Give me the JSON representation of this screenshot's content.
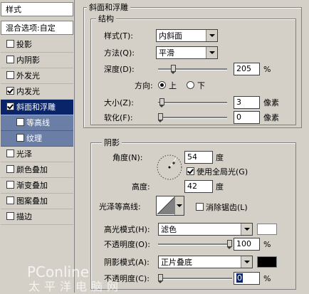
{
  "sidebar": {
    "title": "样式",
    "blend_options": "混合选项:自定",
    "items": [
      {
        "label": "投影",
        "checked": false
      },
      {
        "label": "内阴影",
        "checked": false
      },
      {
        "label": "外发光",
        "checked": false
      },
      {
        "label": "内发光",
        "checked": true
      },
      {
        "label": "斜面和浮雕",
        "checked": true
      },
      {
        "label": "等高线",
        "checked": false
      },
      {
        "label": "纹理",
        "checked": false
      },
      {
        "label": "光泽",
        "checked": false
      },
      {
        "label": "颜色叠加",
        "checked": false
      },
      {
        "label": "渐变叠加",
        "checked": false
      },
      {
        "label": "图案叠加",
        "checked": false
      },
      {
        "label": "描边",
        "checked": false
      }
    ]
  },
  "bevel": {
    "group_title": "斜面和浮雕",
    "structure_title": "结构",
    "style_label": "样式(T):",
    "style_value": "内斜面",
    "technique_label": "方法(Q):",
    "technique_value": "平滑",
    "depth_label": "深度(D):",
    "depth_value": "205",
    "depth_unit": "%",
    "depth_level": 0.2,
    "direction_label": "方向:",
    "direction_up": "上",
    "direction_down": "下",
    "size_label": "大小(Z):",
    "size_value": "3",
    "size_unit": "像素",
    "size_level": 0.02,
    "soften_label": "软化(F):",
    "soften_value": "0",
    "soften_unit": "像素",
    "soften_level": 0
  },
  "shading": {
    "title": "阴影",
    "angle_label": "角度(N):",
    "angle_value": "54",
    "angle_unit": "度",
    "global_light_label": "使用全局光(G)",
    "global_light_checked": true,
    "altitude_label": "高度:",
    "altitude_value": "42",
    "altitude_unit": "度",
    "gloss_label": "光泽等高线:",
    "antialias_label": "消除锯齿(L)",
    "antialias_checked": false,
    "highlight_mode_label": "高光模式(H):",
    "highlight_mode_value": "滤色",
    "highlight_color": "#ffffff",
    "highlight_opacity_label": "不透明度(O):",
    "highlight_opacity_value": "100",
    "highlight_opacity_unit": "%",
    "highlight_opacity_level": 1.0,
    "shadow_mode_label": "阴影模式(A):",
    "shadow_mode_value": "正片叠底",
    "shadow_color": "#000000",
    "shadow_opacity_label": "不透明度(C):",
    "shadow_opacity_value": "0",
    "shadow_opacity_unit": "%",
    "shadow_opacity_level": 0
  },
  "watermark": {
    "brand": "PConline",
    "cn": "太平洋电脑网"
  }
}
